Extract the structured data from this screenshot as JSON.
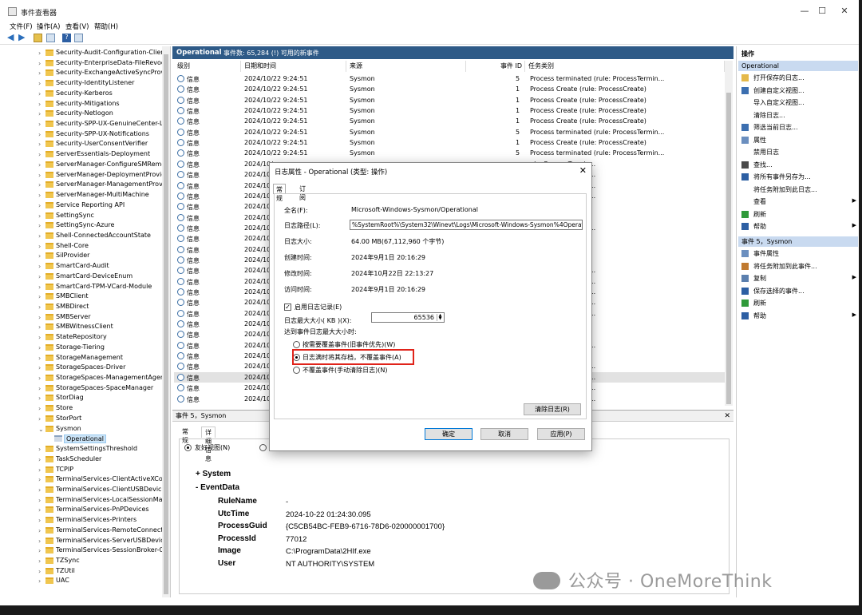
{
  "window": {
    "title": "事件查看器",
    "controls": [
      "—",
      "☐",
      "✕"
    ]
  },
  "menu": [
    "文件(F)",
    "操作(A)",
    "查看(V)",
    "帮助(H)"
  ],
  "tree": {
    "items": [
      "Security-Audit-Configuration-Client",
      "Security-EnterpriseData-FileRevocat",
      "Security-ExchangeActiveSyncProvisi",
      "Security-IdentityListener",
      "Security-Kerberos",
      "Security-Mitigations",
      "Security-Netlogon",
      "Security-SPP-UX-GenuineCenter-Log",
      "Security-SPP-UX-Notifications",
      "Security-UserConsentVerifier",
      "ServerEssentials-Deployment",
      "ServerManager-ConfigureSMRemo",
      "ServerManager-DeploymentProvide",
      "ServerManager-ManagementProvic",
      "ServerManager-MultiMachine",
      "Service Reporting API",
      "SettingSync",
      "SettingSync-Azure",
      "Shell-ConnectedAccountState",
      "Shell-Core",
      "SilProvider",
      "SmartCard-Audit",
      "SmartCard-DeviceEnum",
      "SmartCard-TPM-VCard-Module",
      "SMBClient",
      "SMBDirect",
      "SMBServer",
      "SMBWitnessClient",
      "StateRepository",
      "Storage-Tiering",
      "StorageManagement",
      "StorageSpaces-Driver",
      "StorageSpaces-ManagementAgent",
      "StorageSpaces-SpaceManager",
      "StorDiag",
      "Store",
      "StorPort",
      "Sysmon",
      "Operational",
      "SystemSettingsThreshold",
      "TaskScheduler",
      "TCPIP",
      "TerminalServices-ClientActiveXCore",
      "TerminalServices-ClientUSBDevices",
      "TerminalServices-LocalSessionMana",
      "TerminalServices-PnPDevices",
      "TerminalServices-Printers",
      "TerminalServices-RemoteConnectio",
      "TerminalServices-ServerUSBDevices",
      "TerminalServices-SessionBroker-Cli",
      "TZSync",
      "TZUtil",
      "UAC"
    ]
  },
  "log_header": {
    "name": "Operational",
    "summary": "事件数: 65,284 (!) 可用的新事件"
  },
  "grid": {
    "columns": [
      "级别",
      "日期和时间",
      "来源",
      "事件 ID",
      "任务类别"
    ],
    "rows": [
      {
        "level": "信息",
        "time": "2024/10/22 9:24:51",
        "source": "Sysmon",
        "id": "5",
        "task": "Process terminated (rule: ProcessTermin..."
      },
      {
        "level": "信息",
        "time": "2024/10/22 9:24:51",
        "source": "Sysmon",
        "id": "1",
        "task": "Process Create (rule: ProcessCreate)"
      },
      {
        "level": "信息",
        "time": "2024/10/22 9:24:51",
        "source": "Sysmon",
        "id": "1",
        "task": "Process Create (rule: ProcessCreate)"
      },
      {
        "level": "信息",
        "time": "2024/10/22 9:24:51",
        "source": "Sysmon",
        "id": "1",
        "task": "Process Create (rule: ProcessCreate)"
      },
      {
        "level": "信息",
        "time": "2024/10/22 9:24:51",
        "source": "Sysmon",
        "id": "1",
        "task": "Process Create (rule: ProcessCreate)"
      },
      {
        "level": "信息",
        "time": "2024/10/22 9:24:51",
        "source": "Sysmon",
        "id": "5",
        "task": "Process terminated (rule: ProcessTermin..."
      },
      {
        "level": "信息",
        "time": "2024/10/22 9:24:51",
        "source": "Sysmon",
        "id": "1",
        "task": "Process Create (rule: ProcessCreate)"
      },
      {
        "level": "信息",
        "time": "2024/10/22 9:24:51",
        "source": "Sysmon",
        "id": "5",
        "task": "Process terminated (rule: ProcessTermin..."
      },
      {
        "level": "信息",
        "time": "2024/10/",
        "source": "",
        "id": "",
        "task": "ule: ProcessTermin..."
      },
      {
        "level": "信息",
        "time": "2024/10/",
        "source": "",
        "id": "",
        "task": "ule: ProcessTermin..."
      },
      {
        "level": "信息",
        "time": "2024/10/",
        "source": "",
        "id": "",
        "task": "ule: ProcessTermin..."
      },
      {
        "level": "信息",
        "time": "2024/10/",
        "source": "",
        "id": "",
        "task": "ule: ProcessTermin..."
      },
      {
        "level": "信息",
        "time": "2024/10/",
        "source": "",
        "id": "",
        "task": "ule: ProcessCreate)"
      },
      {
        "level": "信息",
        "time": "2024/10/",
        "source": "",
        "id": "",
        "task": "ule: ProcessCreate)"
      },
      {
        "level": "信息",
        "time": "2024/10/",
        "source": "",
        "id": "",
        "task": "ule: ProcessTermin..."
      },
      {
        "level": "信息",
        "time": "2024/10/",
        "source": "",
        "id": "",
        "task": "ule: ProcessCreate)"
      },
      {
        "level": "信息",
        "time": "2024/10/",
        "source": "",
        "id": "",
        "task": "ule: ProcessCreate)"
      },
      {
        "level": "信息",
        "time": "2024/10/",
        "source": "",
        "id": "",
        "task": "ule: ProcessCreate)"
      },
      {
        "level": "信息",
        "time": "2024/10/",
        "source": "",
        "id": "",
        "task": "ule: ProcessTermin..."
      },
      {
        "level": "信息",
        "time": "2024/10/",
        "source": "",
        "id": "",
        "task": "ule: ProcessTermin..."
      },
      {
        "level": "信息",
        "time": "2024/10/",
        "source": "",
        "id": "",
        "task": "ule: ProcessTermin..."
      },
      {
        "level": "信息",
        "time": "2024/10/",
        "source": "",
        "id": "",
        "task": "ule: ProcessTermin..."
      },
      {
        "level": "信息",
        "time": "2024/10/",
        "source": "",
        "id": "",
        "task": "ule: ProcessTermin..."
      },
      {
        "level": "信息",
        "time": "2024/10/",
        "source": "",
        "id": "",
        "task": "ule: ProcessCreate)"
      },
      {
        "level": "信息",
        "time": "2024/10/",
        "source": "",
        "id": "",
        "task": "ule: ProcessCreate)"
      },
      {
        "level": "信息",
        "time": "2024/10/",
        "source": "",
        "id": "",
        "task": "ule: ProcessTermin..."
      },
      {
        "level": "信息",
        "time": "2024/10/",
        "source": "",
        "id": "",
        "task": "ule: ProcessCreate)"
      },
      {
        "level": "信息",
        "time": "2024/10/",
        "source": "",
        "id": "",
        "task": "ule: ProcessTermin..."
      },
      {
        "level": "信息",
        "time": "2024/10/",
        "source": "",
        "id": "",
        "task": "ule: ProcessTermin..."
      },
      {
        "level": "信息",
        "time": "2024/10/",
        "source": "",
        "id": "",
        "task": "ule: ProcessTermin..."
      },
      {
        "level": "信息",
        "time": "2024/10/",
        "source": "",
        "id": "",
        "task": "ule: ProcessTermin..."
      }
    ]
  },
  "detail": {
    "header": "事件 5，Sysmon",
    "tabs": [
      "常规",
      "详细信息"
    ],
    "view_option": "友好视图(N)",
    "sections": [
      "+ System",
      "- EventData"
    ],
    "fields": [
      {
        "k": "RuleName",
        "v": "-"
      },
      {
        "k": "UtcTime",
        "v": "2024-10-22 01:24:30.095"
      },
      {
        "k": "ProcessGuid",
        "v": "{C5CB54BC-FEB9-6716-78D6-020000001700}"
      },
      {
        "k": "ProcessId",
        "v": "77012"
      },
      {
        "k": "Image",
        "v": "C:\\ProgramData\\2HIf.exe"
      },
      {
        "k": "User",
        "v": "NT AUTHORITY\\SYSTEM"
      }
    ]
  },
  "actions": {
    "title": "操作",
    "sec1": "Operational",
    "sec1_items": [
      {
        "label": "打开保存的日志...",
        "icon": "open-log-icon"
      },
      {
        "label": "创建自定义视图...",
        "icon": "filter-icon"
      },
      {
        "label": "导入自定义视图...",
        "icon": "none"
      },
      {
        "label": "清除日志...",
        "icon": "none"
      },
      {
        "label": "筛选当前日志...",
        "icon": "filter-icon"
      },
      {
        "label": "属性",
        "icon": "properties-icon"
      },
      {
        "label": "禁用日志",
        "icon": "none"
      },
      {
        "label": "查找...",
        "icon": "find-icon"
      },
      {
        "label": "将所有事件另存为...",
        "icon": "save-icon"
      },
      {
        "label": "将任务附加到此日志...",
        "icon": "none"
      },
      {
        "label": "查看",
        "icon": "none",
        "arrow": "▶"
      },
      {
        "label": "刷新",
        "icon": "refresh-icon"
      },
      {
        "label": "帮助",
        "icon": "help-icon",
        "arrow": "▶"
      }
    ],
    "sec2": "事件 5，Sysmon",
    "sec2_items": [
      {
        "label": "事件属性",
        "icon": "event-properties-icon"
      },
      {
        "label": "将任务附加到此事件...",
        "icon": "attach-task-icon"
      },
      {
        "label": "复制",
        "icon": "copy-icon",
        "arrow": "▶"
      },
      {
        "label": "保存选择的事件...",
        "icon": "save-icon"
      },
      {
        "label": "刷新",
        "icon": "refresh-icon"
      },
      {
        "label": "帮助",
        "icon": "help-icon",
        "arrow": "▶"
      }
    ]
  },
  "dialog": {
    "title": "日志属性 - Operational (类型: 操作)",
    "tabs": [
      "常规",
      "订阅"
    ],
    "fields": {
      "full_name_label": "全名(F):",
      "full_name": "Microsoft-Windows-Sysmon/Operational",
      "path_label": "日志路径(L):",
      "path": "%SystemRoot%\\System32\\Winevt\\Logs\\Microsoft-Windows-Sysmon%4Operational.e",
      "size_label": "日志大小:",
      "size": "64.00 MB(67,112,960 个字节)",
      "created_label": "创建时间:",
      "created": "2024年9月1日 20:16:29",
      "modified_label": "修改时间:",
      "modified": "2024年10月22日 22:13:27",
      "accessed_label": "访问时间:",
      "accessed": "2024年9月1日 20:16:29"
    },
    "enable_label": "启用日志记录(E)",
    "max_size_label": "日志最大大小( KB )(X):",
    "max_size": "65536",
    "reached_label": "达到事件日志最大大小时:",
    "options": [
      "按需要覆盖事件(旧事件优先)(W)",
      "日志满时将其存档，不覆盖事件(A)",
      "不覆盖事件(手动清除日志)(N)"
    ],
    "clear_button": "清除日志(R)",
    "ok": "确定",
    "cancel": "取消",
    "apply": "应用(P)",
    "highlight_color": "#e0231a"
  },
  "watermark": "公众号 · OneMoreThink"
}
